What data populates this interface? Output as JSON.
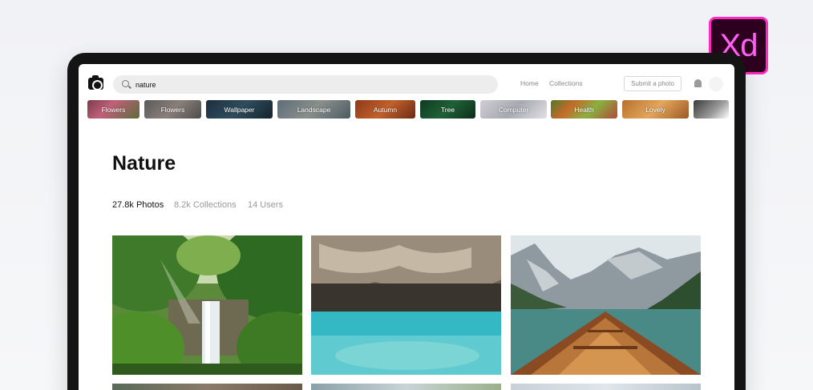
{
  "badge": {
    "label": "Xd",
    "color": "#ff61f6",
    "border": "#ff2bc2",
    "bg": "#2e001f"
  },
  "header": {
    "logo_icon": "camera-icon",
    "search": {
      "value": "nature",
      "icon": "search-icon"
    },
    "nav": [
      {
        "label": "Home"
      },
      {
        "label": "Collections"
      }
    ],
    "submit_label": "Submit a photo",
    "notification_icon": "bell-icon"
  },
  "categories": [
    {
      "label": "Flowers"
    },
    {
      "label": "Flowers"
    },
    {
      "label": "Wallpaper"
    },
    {
      "label": "Landscape"
    },
    {
      "label": "Autumn"
    },
    {
      "label": "Tree"
    },
    {
      "label": "Computer"
    },
    {
      "label": "Health"
    },
    {
      "label": "Lovely"
    },
    {
      "label": ""
    }
  ],
  "main": {
    "title": "Nature",
    "stats": [
      {
        "label": "27.8k Photos",
        "active": true
      },
      {
        "label": "8.2k Collections",
        "active": false
      },
      {
        "label": "14 Users",
        "active": false
      }
    ],
    "photos": [
      {
        "name": "waterfall-forest"
      },
      {
        "name": "cliff-turquoise-water"
      },
      {
        "name": "boat-mountain-lake"
      }
    ]
  }
}
